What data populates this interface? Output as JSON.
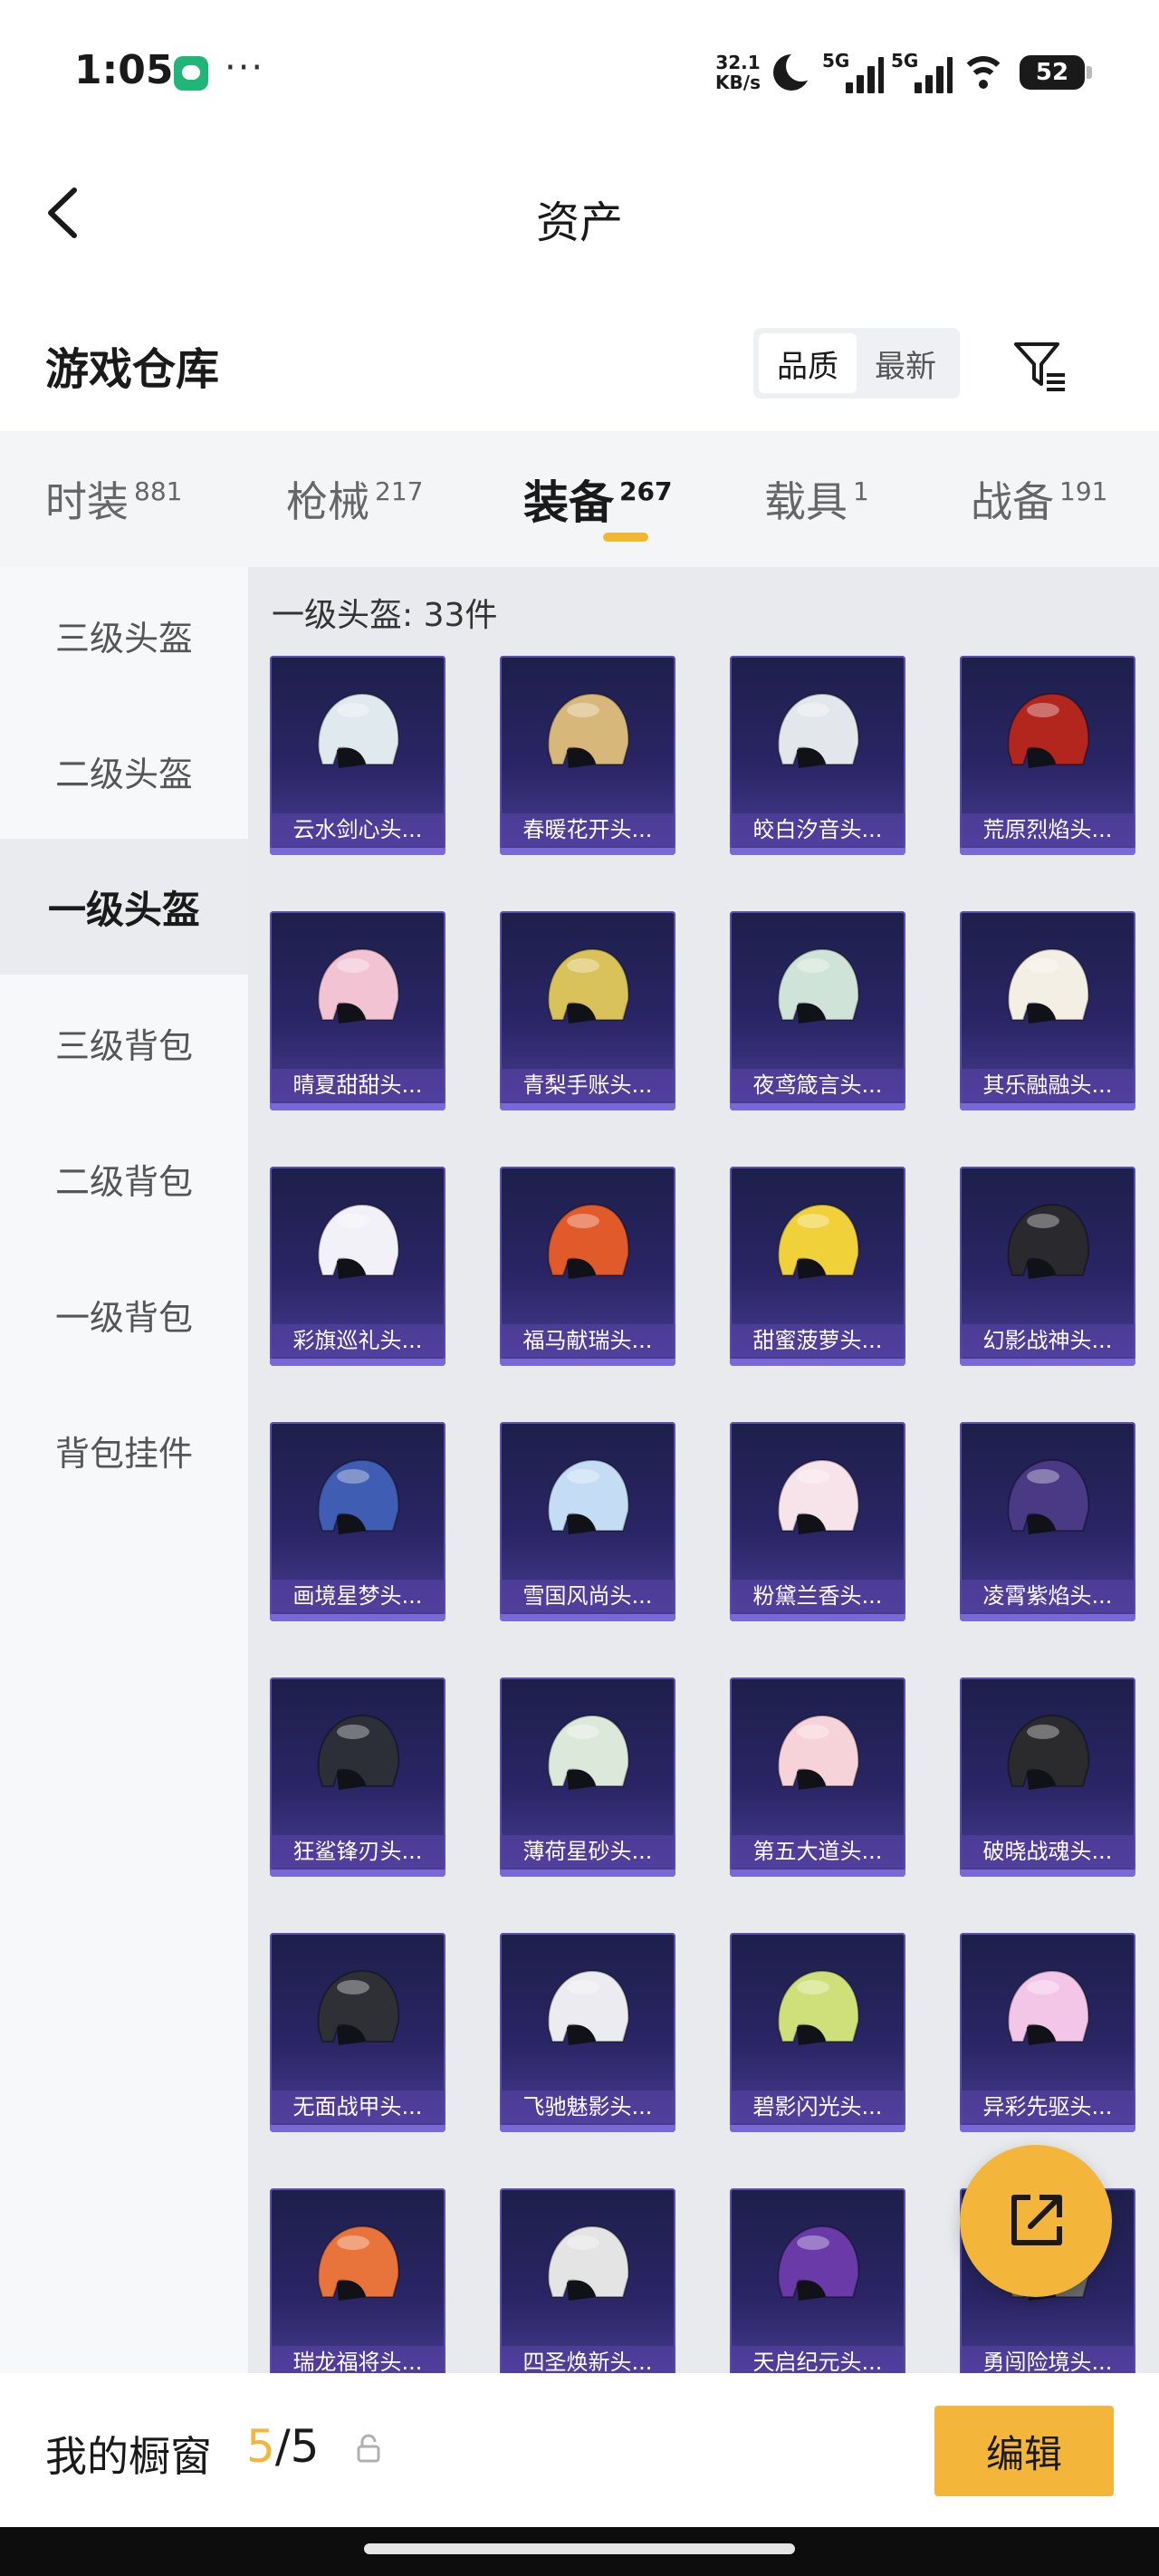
{
  "status_bar": {
    "time": "1:05",
    "more": "···",
    "net_speed_value": "32.1",
    "net_speed_unit": "KB/s",
    "signal1_label": "5G",
    "signal2_label": "5G",
    "battery": "52"
  },
  "nav": {
    "title": "资产"
  },
  "warehouse": {
    "title": "游戏仓库",
    "sort_quality": "品质",
    "sort_newest": "最新",
    "active_sort": "quality"
  },
  "categories": [
    {
      "label": "时装",
      "count": "881"
    },
    {
      "label": "枪械",
      "count": "217"
    },
    {
      "label": "装备",
      "count": "267",
      "active": true
    },
    {
      "label": "载具",
      "count": "1"
    },
    {
      "label": "战备",
      "count": "191"
    }
  ],
  "sidebar": [
    {
      "label": "三级头盔"
    },
    {
      "label": "二级头盔"
    },
    {
      "label": "一级头盔",
      "active": true
    },
    {
      "label": "三级背包"
    },
    {
      "label": "二级背包"
    },
    {
      "label": "一级背包"
    },
    {
      "label": "背包挂件"
    }
  ],
  "section_label": "一级头盔: 33件",
  "items": [
    {
      "name": "云水剑心头...",
      "color": "#dfe9ee"
    },
    {
      "name": "春暖花开头...",
      "color": "#d8b87a"
    },
    {
      "name": "皎白汐音头...",
      "color": "#e3e6ea"
    },
    {
      "name": "荒原烈焰头...",
      "color": "#b3261e"
    },
    {
      "name": "晴夏甜甜头...",
      "color": "#f2c3d3"
    },
    {
      "name": "青梨手账头...",
      "color": "#d9c25a"
    },
    {
      "name": "夜鸢箴言头...",
      "color": "#cfe3d8"
    },
    {
      "name": "其乐融融头...",
      "color": "#f4efe4"
    },
    {
      "name": "彩旗巡礼头...",
      "color": "#f1f1f7"
    },
    {
      "name": "福马献瑞头...",
      "color": "#e05a2a"
    },
    {
      "name": "甜蜜菠萝头...",
      "color": "#f0d13a"
    },
    {
      "name": "幻影战神头...",
      "color": "#2a2a2e"
    },
    {
      "name": "画境星梦头...",
      "color": "#3f5db3"
    },
    {
      "name": "雪国风尚头...",
      "color": "#c4dcf4"
    },
    {
      "name": "粉黛兰香头...",
      "color": "#f6e4ea"
    },
    {
      "name": "凌霄紫焰头...",
      "color": "#4a3a86"
    },
    {
      "name": "狂鲨锋刃头...",
      "color": "#2c2f37"
    },
    {
      "name": "薄荷星砂头...",
      "color": "#dce9da"
    },
    {
      "name": "第五大道头...",
      "color": "#f6d2d9"
    },
    {
      "name": "破晓战魂头...",
      "color": "#2b2b2d"
    },
    {
      "name": "无面战甲头...",
      "color": "#2f3036"
    },
    {
      "name": "飞驰魅影头...",
      "color": "#ecebf0"
    },
    {
      "name": "碧影闪光头...",
      "color": "#cfe07a"
    },
    {
      "name": "异彩先驱头...",
      "color": "#f3c6e8"
    },
    {
      "name": "瑞龙福将头...",
      "color": "#e8733b"
    },
    {
      "name": "四圣焕新头...",
      "color": "#e4e4e4"
    },
    {
      "name": "天启纪元头...",
      "color": "#6a3aa8"
    },
    {
      "name": "勇闯险境头...",
      "color": "#6c6c6c"
    }
  ],
  "bottom": {
    "showcase_label": "我的橱窗",
    "showcase_used": "5",
    "showcase_total": "/5",
    "edit_label": "编辑"
  }
}
